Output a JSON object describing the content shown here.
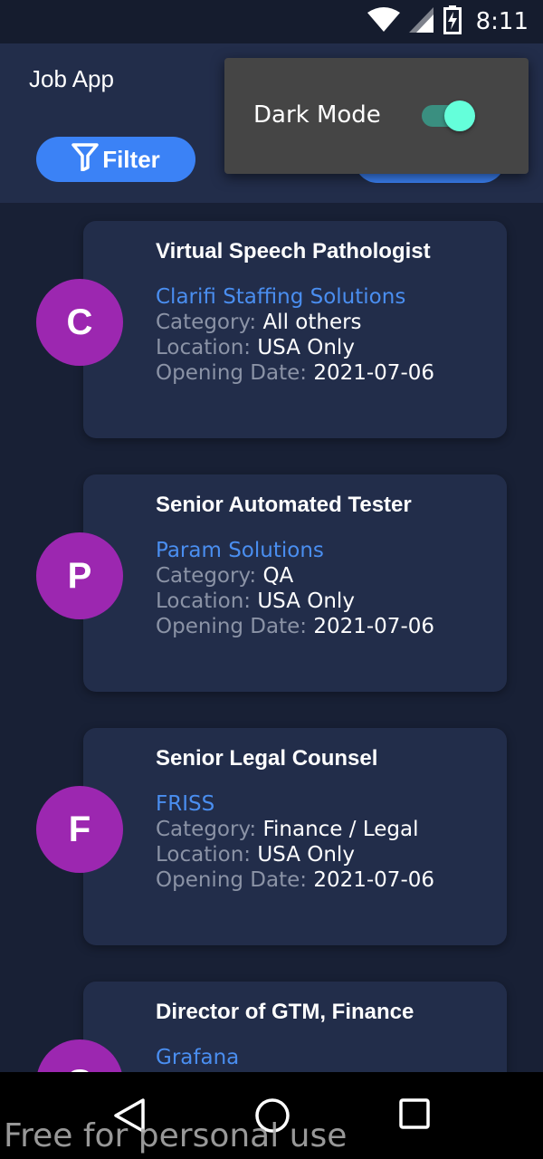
{
  "status_bar": {
    "time": "8:11",
    "icons": [
      "wifi-icon",
      "cell-signal-icon",
      "battery-charging-icon"
    ]
  },
  "app_bar": {
    "title": "Job App",
    "filter_label": "Filter",
    "filter_icon": "funnel-icon"
  },
  "menu": {
    "dark_mode_label": "Dark Mode",
    "dark_mode_on": true
  },
  "labels": {
    "category": "Category:",
    "location": "Location:",
    "opening_date": "Opening Date:"
  },
  "jobs": [
    {
      "initial": "C",
      "title": "Virtual Speech Pathologist",
      "company": "Clarifi Staffing Solutions",
      "category": "All others",
      "location": "USA Only",
      "opening_date": "2021-07-06"
    },
    {
      "initial": "P",
      "title": "Senior Automated Tester",
      "company": "Param Solutions",
      "category": "QA",
      "location": "USA Only",
      "opening_date": "2021-07-06"
    },
    {
      "initial": "F",
      "title": "Senior Legal Counsel",
      "company": "FRISS",
      "category": "Finance / Legal",
      "location": "USA Only",
      "opening_date": "2021-07-06"
    },
    {
      "initial": "G",
      "title": "Director of GTM, Finance",
      "company": "Grafana"
    }
  ],
  "watermark": "Free for personal use",
  "colors": {
    "background": "#182035",
    "card": "#222d4a",
    "accent": "#3b82f6",
    "avatar": "#9c27b0",
    "company_link": "#4a8ef0",
    "toggle_thumb": "#64ffda"
  }
}
